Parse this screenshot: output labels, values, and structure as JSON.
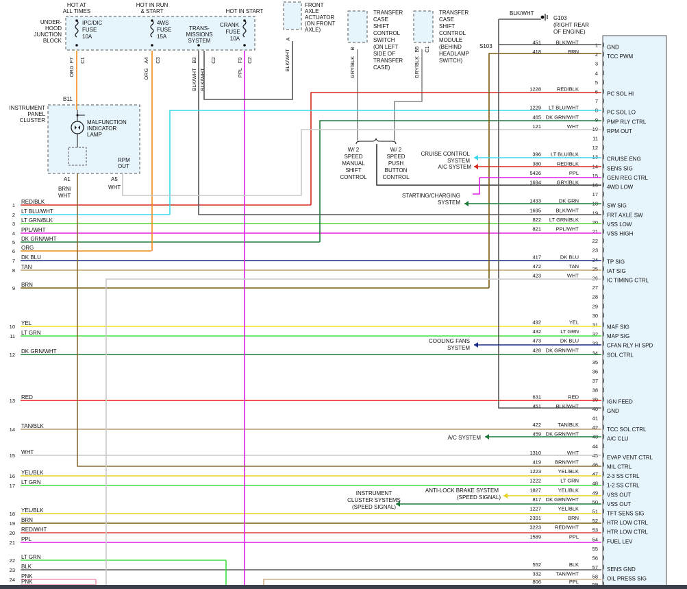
{
  "colors": {
    "RED/BLK": "#d62a1e",
    "LT BLU/WHT": "#38d8ee",
    "LT GRN/BLK": "#5ad23a",
    "PPL/WHT": "#e91ee0",
    "DK GRN/WHT": "#1f7a3a",
    "ORG": "#f08a1c",
    "DK BLU": "#1a2a8c",
    "TAN": "#c4a06e",
    "BRN": "#7a5a10",
    "YEL": "#f2e21a",
    "LT GRN": "#40e040",
    "RED": "#f01818",
    "TAN/BLK": "#b89870",
    "WHT": "#c8c8c8",
    "YEL/BLK": "#e6d21c",
    "RED/WHT": "#e33a3a",
    "PPL": "#e01ee8",
    "BLK": "#555555",
    "PNK": "#f49ab4",
    "GRY/BLK": "#888888",
    "BLK/WHT": "#666666",
    "BRN/WHT": "#8a6a2a",
    "TAN/WHT": "#cbb08a",
    "connector_fill": "#e6f4fb",
    "box_stroke": "#555555"
  },
  "header": {
    "hot_all_times": [
      "HOT AT",
      "ALL TIMES"
    ],
    "hot_run_start": [
      "HOT IN RUN",
      "& START"
    ],
    "hot_start": "HOT IN START",
    "junction_block": [
      "UNDER-",
      "HOOD",
      "JUNCTION",
      "BLOCK"
    ],
    "fuse_ipc": [
      "IPC/DIC",
      "FUSE",
      "10A"
    ],
    "fuse_4ws": [
      "4WS",
      "FUSE",
      "15A"
    ],
    "transmissions": [
      "TRANS-",
      "MISSIONS",
      "SYSTEM"
    ],
    "fuse_crank": [
      "CRANK",
      "FUSE",
      "10A"
    ]
  },
  "top_pins": [
    {
      "pin": "F7",
      "conn": "C1",
      "wire": "ORG"
    },
    {
      "pin": "A4",
      "conn": "C3",
      "wire": "ORG"
    },
    {
      "pin": "B3",
      "conn": "C2",
      "wire": "BLK/WHT"
    },
    {
      "pin": "F9",
      "conn": "C2",
      "wire": "PPL"
    }
  ],
  "actuator": {
    "lines": [
      "FRONT",
      "AXLE",
      "ACTUATOR",
      "(ON FRONT",
      "AXLE)"
    ],
    "pin": "A",
    "wire": "BLK/WHT"
  },
  "tc_switch": {
    "lines": [
      "TRANSFER",
      "CASE",
      "SHIFT",
      "CONTROL",
      "SWITCH",
      "(ON LEFT",
      "SIDE OF",
      "TRANSFER",
      "CASE)"
    ],
    "pin": "B",
    "wire": "GRY/BLK"
  },
  "tc_module": {
    "lines": [
      "TRANSFER",
      "CASE",
      "SHIFT",
      "CONTROL",
      "MODULE",
      "(BEHIND",
      "HEADLAMP",
      "SWITCH)"
    ],
    "pin": "B5",
    "conn": "C1",
    "wire": "GRY/BLK"
  },
  "ground": {
    "wire": "BLK/WHT",
    "name": "G103",
    "desc": [
      "(RIGHT REAR",
      "OF ENGINE)"
    ],
    "splice": "S103"
  },
  "shift_controls": {
    "manual": [
      "W/ 2",
      "SPEED",
      "MANUAL",
      "SHIFT",
      "CONTROL"
    ],
    "push": [
      "W/ 2",
      "SPEED",
      "PUSH",
      "BUTTON",
      "CONTROL"
    ]
  },
  "cluster": {
    "title": [
      "INSTRUMENT",
      "PANEL",
      "CLUSTER"
    ],
    "pin_top": "B11",
    "mil": [
      "MALFUNCTION",
      "INDICATOR",
      "LAMP"
    ],
    "rpm": [
      "RPM",
      "OUT"
    ],
    "pin_a1": "A1",
    "pin_a5": "A5",
    "wire_a1": [
      "BRN/",
      "WHT"
    ],
    "wire_a5": "WHT"
  },
  "systems": {
    "cruise": [
      "CRUISE CONTROL",
      "SYSTEM"
    ],
    "ac": "A/C SYSTEM",
    "charging": [
      "STARTING/CHARGING",
      "SYSTEM"
    ],
    "fans": [
      "COOLING FANS",
      "SYSTEM"
    ],
    "ac2": "A/C SYSTEM",
    "abs": [
      "ANTI-LOCK BRAKE SYSTEM",
      "(SPEED SIGNAL)"
    ],
    "cluster_sys": [
      "INSTRUMENT",
      "CLUSTER SYSTEMS",
      "(SPEED SIGNAL)"
    ]
  },
  "left_wires": [
    {
      "num": "1",
      "label": "RED/BLK"
    },
    {
      "num": "2",
      "label": "LT BLU/WHT"
    },
    {
      "num": "3",
      "label": "LT GRN/BLK"
    },
    {
      "num": "4",
      "label": "PPL/WHT"
    },
    {
      "num": "5",
      "label": "DK GRN/WHT"
    },
    {
      "num": "6",
      "label": "ORG"
    },
    {
      "num": "7",
      "label": "DK BLU"
    },
    {
      "num": "8",
      "label": "TAN"
    },
    {
      "num": "9",
      "label": "BRN"
    },
    {
      "num": "10",
      "label": "YEL"
    },
    {
      "num": "11",
      "label": "LT GRN"
    },
    {
      "num": "12",
      "label": "DK GRN/WHT"
    },
    {
      "num": "13",
      "label": "RED"
    },
    {
      "num": "14",
      "label": "TAN/BLK"
    },
    {
      "num": "15",
      "label": "WHT"
    },
    {
      "num": "16",
      "label": "YEL/BLK"
    },
    {
      "num": "17",
      "label": "LT GRN"
    },
    {
      "num": "18",
      "label": "YEL/BLK"
    },
    {
      "num": "19",
      "label": "BRN"
    },
    {
      "num": "20",
      "label": "RED/WHT"
    },
    {
      "num": "21",
      "label": "PPL"
    },
    {
      "num": "22",
      "label": "LT GRN"
    },
    {
      "num": "23",
      "label": "BLK"
    },
    {
      "num": "24",
      "label": "PNK"
    },
    {
      "num": "",
      "label": "PNK"
    }
  ],
  "ecm_pins": [
    {
      "pin": "1",
      "circuit": "451",
      "color": "BLK/WHT",
      "func": "GND"
    },
    {
      "pin": "2",
      "circuit": "418",
      "color": "BRN",
      "func": "TCC PWM"
    },
    {
      "pin": "3"
    },
    {
      "pin": "4"
    },
    {
      "pin": "5"
    },
    {
      "pin": "6",
      "circuit": "1228",
      "color": "RED/BLK",
      "func": "PC SOL HI"
    },
    {
      "pin": "7"
    },
    {
      "pin": "8",
      "circuit": "1229",
      "color": "LT BLU/WHT",
      "func": "PC SOL LO"
    },
    {
      "pin": "9",
      "circuit": "465",
      "color": "DK GRN/WHT",
      "func": "PMP RLY CTRL"
    },
    {
      "pin": "10",
      "circuit": "121",
      "color": "WHT",
      "func": "RPM OUT"
    },
    {
      "pin": "11"
    },
    {
      "pin": "12"
    },
    {
      "pin": "13",
      "circuit": "396",
      "color": "LT BLU/BLK",
      "func": "CRUISE ENG"
    },
    {
      "pin": "14",
      "circuit": "380",
      "color": "RED/BLK",
      "func": "SENS SIG"
    },
    {
      "pin": "15",
      "circuit": "5426",
      "color": "PPL",
      "func": "GEN REG CTRL"
    },
    {
      "pin": "16",
      "circuit": "1694",
      "color": "GRY/BLK",
      "func": "4WD LOW"
    },
    {
      "pin": "17"
    },
    {
      "pin": "18",
      "circuit": "1433",
      "color": "DK GRN",
      "func": "SW SIG"
    },
    {
      "pin": "19",
      "circuit": "1695",
      "color": "BLK/WHT",
      "func": "FRT AXLE SW"
    },
    {
      "pin": "20",
      "circuit": "822",
      "color": "LT GRN/BLK",
      "func": "VSS LOW"
    },
    {
      "pin": "21",
      "circuit": "821",
      "color": "PPL/WHT",
      "func": "VSS HIGH"
    },
    {
      "pin": "22"
    },
    {
      "pin": "23"
    },
    {
      "pin": "24",
      "circuit": "417",
      "color": "DK BLU",
      "func": "TP SIG"
    },
    {
      "pin": "25",
      "circuit": "472",
      "color": "TAN",
      "func": "IAT SIG"
    },
    {
      "pin": "26",
      "circuit": "423",
      "color": "WHT",
      "func": "IC TIMING CTRL"
    },
    {
      "pin": "27"
    },
    {
      "pin": "28"
    },
    {
      "pin": "29"
    },
    {
      "pin": "30"
    },
    {
      "pin": "31",
      "circuit": "492",
      "color": "YEL",
      "func": "MAF SIG"
    },
    {
      "pin": "32",
      "circuit": "432",
      "color": "LT GRN",
      "func": "MAP SIG"
    },
    {
      "pin": "33",
      "circuit": "473",
      "color": "DK BLU",
      "func": "CFAN RLY HI SPD"
    },
    {
      "pin": "34",
      "circuit": "428",
      "color": "DK GRN/WHT",
      "func": "SOL CTRL"
    },
    {
      "pin": "35"
    },
    {
      "pin": "36"
    },
    {
      "pin": "37"
    },
    {
      "pin": "38"
    },
    {
      "pin": "39",
      "circuit": "631",
      "color": "RED",
      "func": "IGN FEED"
    },
    {
      "pin": "40",
      "circuit": "451",
      "color": "BLK/WHT",
      "func": "GND"
    },
    {
      "pin": "41"
    },
    {
      "pin": "42",
      "circuit": "422",
      "color": "TAN/BLK",
      "func": "TCC SOL CTRL"
    },
    {
      "pin": "43",
      "circuit": "459",
      "color": "DK GRN/WHT",
      "func": "A/C CLU"
    },
    {
      "pin": "44"
    },
    {
      "pin": "45",
      "circuit": "1310",
      "color": "WHT",
      "func": "EVAP VENT CTRL"
    },
    {
      "pin": "46",
      "circuit": "419",
      "color": "BRN/WHT",
      "func": "MIL CTRL"
    },
    {
      "pin": "47",
      "circuit": "1223",
      "color": "YEL/BLK",
      "func": "2-3 SS CTRL"
    },
    {
      "pin": "48",
      "circuit": "1222",
      "color": "LT GRN",
      "func": "1-2 SS CTRL"
    },
    {
      "pin": "49",
      "circuit": "1827",
      "color": "YEL/BLK",
      "func": "VSS OUT"
    },
    {
      "pin": "50",
      "circuit": "817",
      "color": "DK GRN/WHT",
      "func": "VSS OUT"
    },
    {
      "pin": "51",
      "circuit": "1227",
      "color": "YEL/BLK",
      "func": "TFT SENS SIG"
    },
    {
      "pin": "52",
      "circuit": "2391",
      "color": "BRN",
      "func": "HTR LOW CTRL"
    },
    {
      "pin": "53",
      "circuit": "3223",
      "color": "RED/WHT",
      "func": "HTR LOW CTRL"
    },
    {
      "pin": "54",
      "circuit": "1589",
      "color": "PPL",
      "func": "FUEL LEV"
    },
    {
      "pin": "55"
    },
    {
      "pin": "56"
    },
    {
      "pin": "57",
      "circuit": "552",
      "color": "BLK",
      "func": "SENS GND"
    },
    {
      "pin": "58",
      "circuit": "332",
      "color": "TAN/WHT",
      "func": "OIL PRESS SIG"
    },
    {
      "pin": "59",
      "circuit": "806",
      "color": "PPL"
    }
  ]
}
